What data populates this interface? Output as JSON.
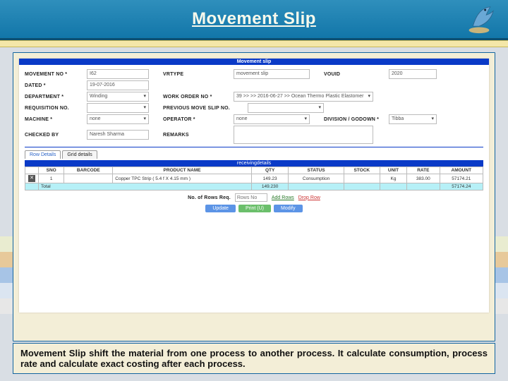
{
  "header": {
    "title": "Movement Slip"
  },
  "app": {
    "title": "Movement slip",
    "fields": {
      "movementNo": {
        "label": "MOVEMENT NO *",
        "value": "I62"
      },
      "vrtype": {
        "label": "VRTYPE",
        "value": "movement slip"
      },
      "vouid": {
        "label": "VOUID",
        "value": "2020"
      },
      "dated": {
        "label": "DATED *",
        "value": "19-07-2016"
      },
      "department": {
        "label": "DEPARTMENT *",
        "value": "Winding"
      },
      "workOrder": {
        "label": "WORK ORDER NO *",
        "value": "39 >> >> 2016-06-27 >> Ocean Thermo Plastic Elastomer"
      },
      "reqNo": {
        "label": "REQUISITION NO.",
        "value": ""
      },
      "prevMove": {
        "label": "PREVIOUS MOVE SLIP NO.",
        "value": ""
      },
      "machine": {
        "label": "MACHINE *",
        "value": "none"
      },
      "operator": {
        "label": "OPERATOR *",
        "value": "none"
      },
      "division": {
        "label": "DIVISION / GODOWN *",
        "value": "Tibba"
      },
      "checkedBy": {
        "label": "CHECKED BY",
        "value": "Naresh Sharma"
      },
      "remarks": {
        "label": "REMARKS",
        "value": ""
      }
    },
    "tabs": {
      "t1": "Row Details",
      "t2": "Grid details"
    },
    "gridTitle": "receivingdetails",
    "gridHeaders": {
      "sno": "SNO",
      "barcode": "BARCODE",
      "product": "PRODUCT NAME",
      "qty": "QTY",
      "status": "STATUS",
      "stock": "STOCK",
      "unit": "UNIT",
      "rate": "RATE",
      "amount": "AMOUNT"
    },
    "gridRow": {
      "sno": "1",
      "barcode": "",
      "product": "Copper TPC Strip ( 5.4 f X 4.15 mm )",
      "qty": "149.23",
      "status": "Consumption",
      "stock": "",
      "unit": "Kg",
      "rate": "383.00",
      "amount": "57174.21"
    },
    "totals": {
      "label": "Total",
      "qty": "149.230",
      "amount": "57174.24"
    },
    "rowControls": {
      "label": "No. of Rows Req.",
      "placeholder": "Rows No",
      "addRows": "Add Rows",
      "dropRow": "Drop Row"
    },
    "buttons": {
      "update": "Update",
      "print": "Print (U)",
      "modify": "Modify"
    }
  },
  "caption": "Movement Slip shift the material from one process to another process. It calculate consumption, process rate and calculate exact costing after each process."
}
